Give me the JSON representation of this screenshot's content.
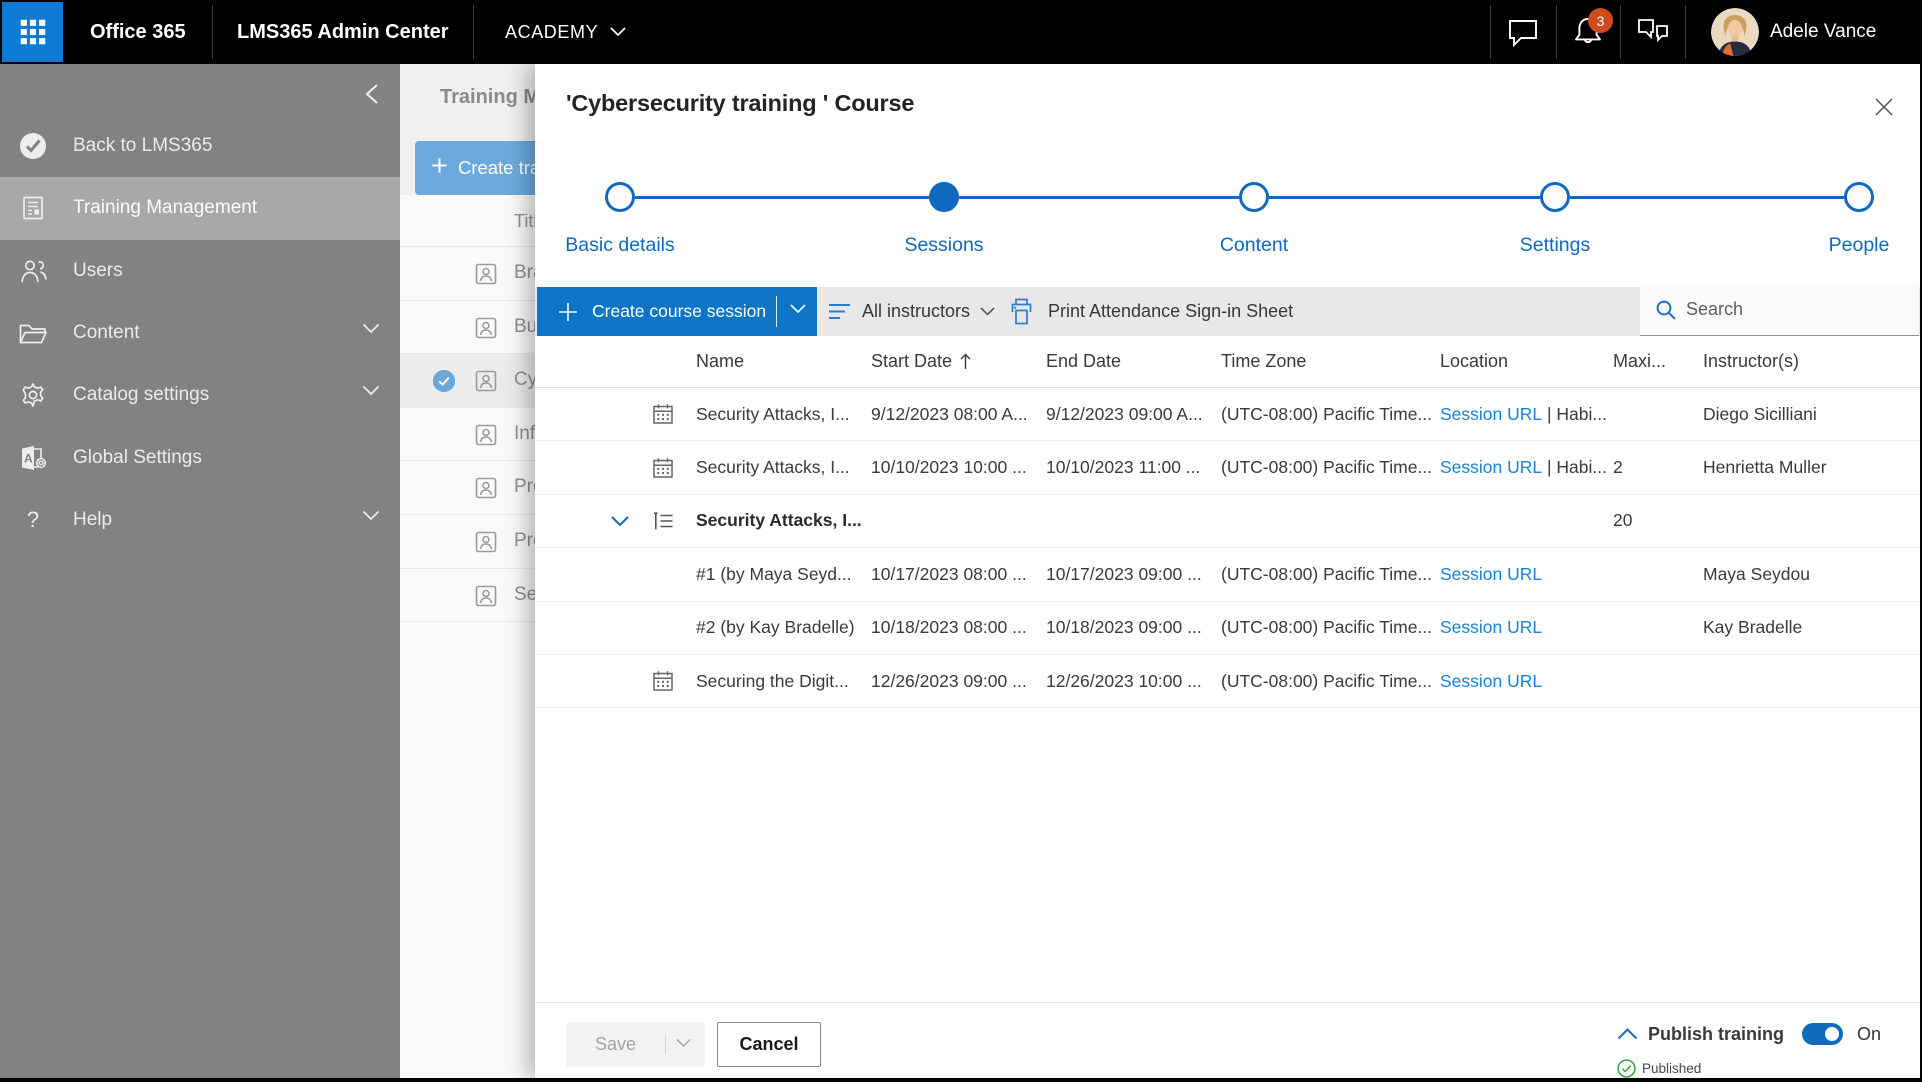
{
  "colors": {
    "accent": "#1068bf",
    "btn_blue": "#0d74c6",
    "link_blue": "#1583d7",
    "toggle_blue": "#0f6cbd",
    "waffle_blue": "#0e7ad3",
    "badge_orange": "#cf4a1f",
    "cmdbar_icon_blue": "#2b7cd3",
    "published_green": "#38a038",
    "sidebar_gray": "#828282",
    "sidebar_selected_gray": "#a8a8a8"
  },
  "topbar": {
    "waffle_icon": "app-launcher-icon",
    "brand": "Office 365",
    "admin_center": "LMS365 Admin Center",
    "tenant": "ACADEMY",
    "tenant_chevron_icon": "chevron-down-icon",
    "chat_icon": "chat-icon",
    "bell_icon": "bell-icon",
    "notification_count": "3",
    "feedback_icon": "feedback-icon",
    "avatar_icon": "user-avatar",
    "user_name": "Adele Vance"
  },
  "sidebar": {
    "collapse_icon": "chevron-left-icon",
    "items": [
      {
        "icon": "circle-check-logo-icon",
        "label": "Back to LMS365",
        "selected": false,
        "has_chevron": false
      },
      {
        "icon": "training-management-icon",
        "label": "Training Management",
        "selected": true,
        "has_chevron": false
      },
      {
        "icon": "users-icon",
        "label": "Users",
        "selected": false,
        "has_chevron": false
      },
      {
        "icon": "folder-icon",
        "label": "Content",
        "selected": false,
        "has_chevron": true
      },
      {
        "icon": "gear-icon",
        "label": "Catalog settings",
        "selected": false,
        "has_chevron": true
      },
      {
        "icon": "global-settings-icon",
        "label": "Global Settings",
        "selected": false,
        "has_chevron": true,
        "chevron_hidden": true
      },
      {
        "icon": "help-icon",
        "label": "Help",
        "selected": false,
        "has_chevron": true
      }
    ]
  },
  "background_page": {
    "title": "Training M",
    "create_button": "Create tra",
    "column_header": "Titl",
    "rows": [
      {
        "label": "Bra",
        "selected": false
      },
      {
        "label": "Bu",
        "selected": false
      },
      {
        "label": "Cy",
        "selected": true
      },
      {
        "label": "Inf",
        "selected": false
      },
      {
        "label": "Pro",
        "selected": false
      },
      {
        "label": "Pro",
        "selected": false
      },
      {
        "label": "Se",
        "selected": false
      }
    ]
  },
  "modal": {
    "title": "'Cybersecurity training ' Course",
    "close_icon": "close-icon",
    "stepper": {
      "steps": [
        {
          "label": "Basic details",
          "active": false
        },
        {
          "label": "Sessions",
          "active": true
        },
        {
          "label": "Content",
          "active": false
        },
        {
          "label": "Settings",
          "active": false
        },
        {
          "label": "People",
          "active": false
        }
      ]
    },
    "toolbar": {
      "create_button": "Create course session",
      "create_chevron_icon": "chevron-down-icon",
      "filter_icon": "filter-icon",
      "filter_label": "All instructors",
      "filter_chevron_icon": "chevron-down-icon",
      "print_icon": "printer-icon",
      "print_label": "Print Attendance Sign-in Sheet",
      "search_icon": "search-icon",
      "search_placeholder": "Search",
      "search_value": ""
    },
    "table": {
      "columns": [
        "Name",
        "Start Date",
        "End Date",
        "Time Zone",
        "Location",
        "Maxi...",
        "Instructor(s)"
      ],
      "sort_column": "Start Date",
      "sort_direction": "ascending",
      "rows": [
        {
          "icon": "calendar-icon",
          "expander": false,
          "bold": false,
          "name": "Security Attacks, I...",
          "start": "9/12/2023 08:00 A...",
          "end": "9/12/2023 09:00 A...",
          "timezone": "(UTC-08:00) Pacific Time...",
          "location_link": "Session URL",
          "location_extra": " | Habi...",
          "max": "",
          "instructors": "Diego Sicilliani"
        },
        {
          "icon": "calendar-icon",
          "expander": false,
          "bold": false,
          "name": "Security Attacks, I...",
          "start": "10/10/2023 10:00 ...",
          "end": "10/10/2023 11:00 ...",
          "timezone": "(UTC-08:00) Pacific Time...",
          "location_link": "Session URL",
          "location_extra": " | Habi...",
          "max": "2",
          "instructors": "Henrietta Muller"
        },
        {
          "icon": "session-group-icon",
          "expander": true,
          "bold": true,
          "name": "Security Attacks, I...",
          "start": "",
          "end": "",
          "timezone": "",
          "location_link": "",
          "location_extra": "",
          "max": "20",
          "instructors": ""
        },
        {
          "icon": "",
          "expander": false,
          "bold": false,
          "name": "#1 (by Maya Seyd...",
          "start": "10/17/2023 08:00 ...",
          "end": "10/17/2023 09:00 ...",
          "timezone": "(UTC-08:00) Pacific Time...",
          "location_link": "Session URL",
          "location_extra": "",
          "max": "",
          "instructors": "Maya Seydou"
        },
        {
          "icon": "",
          "expander": false,
          "bold": false,
          "name": "#2 (by Kay Bradelle)",
          "start": "10/18/2023 08:00 ...",
          "end": "10/18/2023 09:00 ...",
          "timezone": "(UTC-08:00) Pacific Time...",
          "location_link": "Session URL",
          "location_extra": "",
          "max": "",
          "instructors": "Kay Bradelle"
        },
        {
          "icon": "calendar-icon",
          "expander": false,
          "bold": false,
          "name": "Securing the Digit...",
          "start": "12/26/2023 09:00 ...",
          "end": "12/26/2023 10:00 ...",
          "timezone": "(UTC-08:00) Pacific Time...",
          "location_link": "Session URL",
          "location_extra": "",
          "max": "",
          "instructors": ""
        }
      ]
    },
    "footer": {
      "save_label": "Save",
      "save_chevron_icon": "chevron-down-icon",
      "cancel_label": "Cancel",
      "publish_chevron_icon": "chevron-up-icon",
      "publish_label": "Publish training",
      "toggle_state": "On",
      "status_icon": "check-circle-icon",
      "status_label": "Published"
    }
  }
}
